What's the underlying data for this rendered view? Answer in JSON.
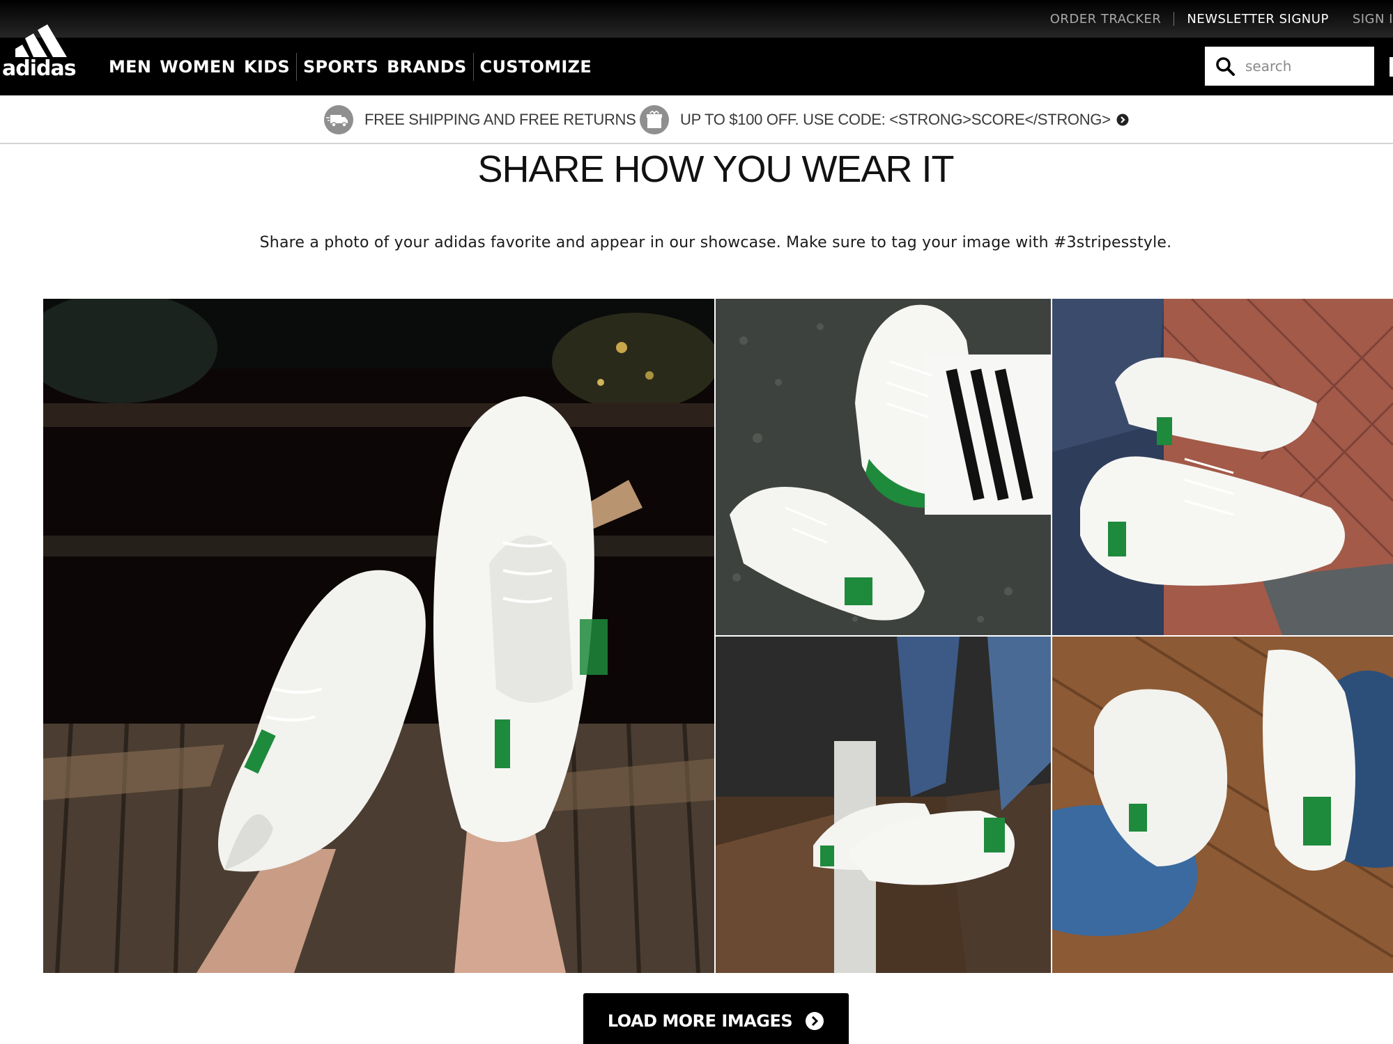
{
  "utility": {
    "order_tracker": "ORDER TRACKER",
    "newsletter_signup": "NEWSLETTER SIGNUP",
    "sign_in": "SIGN I"
  },
  "brand": {
    "logo_alt": "adidas",
    "wordmark": "adidas"
  },
  "nav": {
    "men": "MEN",
    "women": "WOMEN",
    "kids": "KIDS",
    "sports": "SPORTS",
    "brands": "BRANDS",
    "customize": "CUSTOMIZE"
  },
  "search": {
    "placeholder": "search",
    "value": ""
  },
  "promos": [
    {
      "text": "FREE SHIPPING AND FREE RETURNS",
      "icon": "truck-icon"
    },
    {
      "text": "UP TO $100 OFF. USE CODE: <STRONG>SCORE</STRONG>",
      "icon": "gift-icon"
    }
  ],
  "content": {
    "title": "SHARE HOW YOU WEAR IT",
    "description": "Share a photo of your adidas favorite and appear in our showcase. Make sure to tag your image with #3stripesstyle.",
    "load_more": "LOAD MORE IMAGES"
  },
  "gallery": {
    "photos": [
      "white sneakers with green heel tabs worn crossed over a wooden deck",
      "white sneaker and striped sock over asphalt",
      "white sneakers with jeans on red brick",
      "white sneakers with jeans on a wooden floor step",
      "white sneaker with green heel tab on a wood floor"
    ]
  },
  "colors": {
    "nav_background": "#000000",
    "shoe_green": "#1e8a3c",
    "promo_icon": "#8f8f8f"
  }
}
